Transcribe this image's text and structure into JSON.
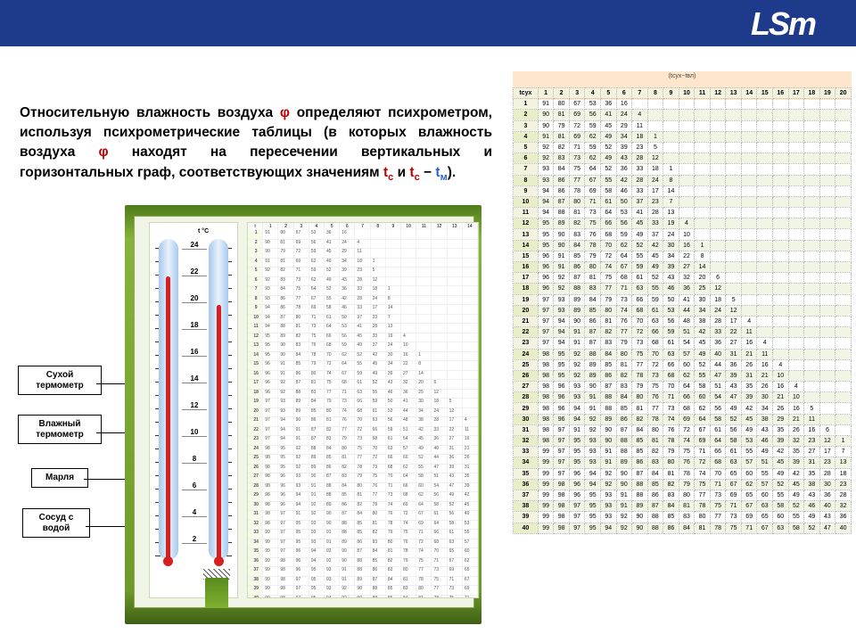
{
  "brand": "LSm",
  "paragraph": {
    "p1a": "Относительную влажность воздуха ",
    "phi": "φ",
    "p1b": " определяют психрометром, используя психрометрические таблицы (в которых влажность воздуха ",
    "p1c": " находят на пересечении вертикальных и горизонтальных граф, соответствующих значениям ",
    "tc": "t",
    "tc_sub": "с",
    "and": " и ",
    "tc2": "t",
    "tc2_sub": "с",
    "minus": " − ",
    "tm": "t",
    "tm_sub": "м",
    "p1d": ")."
  },
  "diagram": {
    "tc_label": "t °C",
    "scale": [
      "24",
      "22",
      "20",
      "18",
      "16",
      "14",
      "12",
      "10",
      "8",
      "6",
      "4",
      "2"
    ],
    "callouts": {
      "dry": "Сухой\nтермометр",
      "wet": "Влажный\nтермометр",
      "gauze": "Марля",
      "vessel": "Сосуд с\nводой"
    }
  },
  "big_table": {
    "header_note": "(tсух−tвл)",
    "row_head": "tсух",
    "cols": [
      "1",
      "2",
      "3",
      "4",
      "5",
      "6",
      "7",
      "8",
      "9",
      "10",
      "11",
      "12",
      "13",
      "14",
      "15",
      "16",
      "17",
      "18",
      "19",
      "20"
    ],
    "rows": [
      {
        "t": "1",
        "v": [
          "91",
          "80",
          "67",
          "53",
          "36",
          "16",
          "",
          "",
          "",
          "",
          "",
          "",
          "",
          "",
          "",
          "",
          "",
          "",
          "",
          ""
        ]
      },
      {
        "t": "2",
        "v": [
          "90",
          "81",
          "69",
          "56",
          "41",
          "24",
          "4",
          "",
          "",
          "",
          "",
          "",
          "",
          "",
          "",
          "",
          "",
          "",
          "",
          ""
        ]
      },
      {
        "t": "3",
        "v": [
          "90",
          "79",
          "72",
          "59",
          "45",
          "29",
          "11",
          "",
          "",
          "",
          "",
          "",
          "",
          "",
          "",
          "",
          "",
          "",
          "",
          ""
        ]
      },
      {
        "t": "4",
        "v": [
          "91",
          "81",
          "69",
          "62",
          "49",
          "34",
          "18",
          "1",
          "",
          "",
          "",
          "",
          "",
          "",
          "",
          "",
          "",
          "",
          "",
          ""
        ]
      },
      {
        "t": "5",
        "v": [
          "92",
          "82",
          "71",
          "59",
          "52",
          "39",
          "23",
          "5",
          "",
          "",
          "",
          "",
          "",
          "",
          "",
          "",
          "",
          "",
          "",
          ""
        ]
      },
      {
        "t": "6",
        "v": [
          "92",
          "83",
          "73",
          "62",
          "49",
          "43",
          "28",
          "12",
          "",
          "",
          "",
          "",
          "",
          "",
          "",
          "",
          "",
          "",
          "",
          ""
        ]
      },
      {
        "t": "7",
        "v": [
          "93",
          "84",
          "75",
          "64",
          "52",
          "36",
          "33",
          "18",
          "1",
          "",
          "",
          "",
          "",
          "",
          "",
          "",
          "",
          "",
          "",
          ""
        ]
      },
      {
        "t": "8",
        "v": [
          "93",
          "86",
          "77",
          "67",
          "55",
          "42",
          "28",
          "24",
          "8",
          "",
          "",
          "",
          "",
          "",
          "",
          "",
          "",
          "",
          "",
          ""
        ]
      },
      {
        "t": "9",
        "v": [
          "94",
          "86",
          "78",
          "69",
          "58",
          "46",
          "33",
          "17",
          "14",
          "",
          "",
          "",
          "",
          "",
          "",
          "",
          "",
          "",
          "",
          ""
        ]
      },
      {
        "t": "10",
        "v": [
          "94",
          "87",
          "80",
          "71",
          "61",
          "50",
          "37",
          "23",
          "7",
          "",
          "",
          "",
          "",
          "",
          "",
          "",
          "",
          "",
          "",
          ""
        ]
      },
      {
        "t": "11",
        "v": [
          "94",
          "88",
          "81",
          "73",
          "64",
          "53",
          "41",
          "28",
          "13",
          "",
          "",
          "",
          "",
          "",
          "",
          "",
          "",
          "",
          "",
          ""
        ]
      },
      {
        "t": "12",
        "v": [
          "95",
          "89",
          "82",
          "75",
          "66",
          "56",
          "45",
          "33",
          "19",
          "4",
          "",
          "",
          "",
          "",
          "",
          "",
          "",
          "",
          "",
          ""
        ]
      },
      {
        "t": "13",
        "v": [
          "95",
          "90",
          "83",
          "76",
          "68",
          "59",
          "49",
          "37",
          "24",
          "10",
          "",
          "",
          "",
          "",
          "",
          "",
          "",
          "",
          "",
          ""
        ]
      },
      {
        "t": "14",
        "v": [
          "95",
          "90",
          "84",
          "78",
          "70",
          "62",
          "52",
          "42",
          "30",
          "16",
          "1",
          "",
          "",
          "",
          "",
          "",
          "",
          "",
          "",
          ""
        ]
      },
      {
        "t": "15",
        "v": [
          "96",
          "91",
          "85",
          "79",
          "72",
          "64",
          "55",
          "45",
          "34",
          "22",
          "8",
          "",
          "",
          "",
          "",
          "",
          "",
          "",
          "",
          ""
        ]
      },
      {
        "t": "16",
        "v": [
          "96",
          "91",
          "86",
          "80",
          "74",
          "67",
          "59",
          "49",
          "39",
          "27",
          "14",
          "",
          "",
          "",
          "",
          "",
          "",
          "",
          "",
          ""
        ]
      },
      {
        "t": "17",
        "v": [
          "96",
          "92",
          "87",
          "81",
          "75",
          "68",
          "61",
          "52",
          "43",
          "32",
          "20",
          "6",
          "",
          "",
          "",
          "",
          "",
          "",
          "",
          ""
        ]
      },
      {
        "t": "18",
        "v": [
          "96",
          "92",
          "88",
          "83",
          "77",
          "71",
          "63",
          "55",
          "46",
          "36",
          "25",
          "12",
          "",
          "",
          "",
          "",
          "",
          "",
          "",
          ""
        ]
      },
      {
        "t": "19",
        "v": [
          "97",
          "93",
          "89",
          "84",
          "79",
          "73",
          "66",
          "59",
          "50",
          "41",
          "30",
          "18",
          "5",
          "",
          "",
          "",
          "",
          "",
          "",
          ""
        ]
      },
      {
        "t": "20",
        "v": [
          "97",
          "93",
          "89",
          "85",
          "80",
          "74",
          "68",
          "61",
          "53",
          "44",
          "34",
          "24",
          "12",
          "",
          "",
          "",
          "",
          "",
          "",
          ""
        ]
      },
      {
        "t": "21",
        "v": [
          "97",
          "94",
          "90",
          "86",
          "81",
          "76",
          "70",
          "63",
          "56",
          "48",
          "38",
          "28",
          "17",
          "4",
          "",
          "",
          "",
          "",
          "",
          ""
        ]
      },
      {
        "t": "22",
        "v": [
          "97",
          "94",
          "91",
          "87",
          "82",
          "77",
          "72",
          "66",
          "59",
          "51",
          "42",
          "33",
          "22",
          "11",
          "",
          "",
          "",
          "",
          "",
          ""
        ]
      },
      {
        "t": "23",
        "v": [
          "97",
          "94",
          "91",
          "87",
          "83",
          "79",
          "73",
          "68",
          "61",
          "54",
          "45",
          "36",
          "27",
          "16",
          "4",
          "",
          "",
          "",
          "",
          ""
        ]
      },
      {
        "t": "24",
        "v": [
          "98",
          "95",
          "92",
          "88",
          "84",
          "80",
          "75",
          "70",
          "63",
          "57",
          "49",
          "40",
          "31",
          "21",
          "11",
          "",
          "",
          "",
          "",
          ""
        ]
      },
      {
        "t": "25",
        "v": [
          "98",
          "95",
          "92",
          "89",
          "85",
          "81",
          "77",
          "72",
          "66",
          "60",
          "52",
          "44",
          "36",
          "26",
          "16",
          "4",
          "",
          "",
          "",
          ""
        ]
      },
      {
        "t": "26",
        "v": [
          "98",
          "95",
          "92",
          "89",
          "86",
          "82",
          "78",
          "73",
          "68",
          "62",
          "55",
          "47",
          "39",
          "31",
          "21",
          "10",
          "",
          "",
          "",
          ""
        ]
      },
      {
        "t": "27",
        "v": [
          "98",
          "96",
          "93",
          "90",
          "87",
          "83",
          "79",
          "75",
          "70",
          "64",
          "58",
          "51",
          "43",
          "35",
          "26",
          "16",
          "4",
          "",
          "",
          ""
        ]
      },
      {
        "t": "28",
        "v": [
          "98",
          "96",
          "93",
          "91",
          "88",
          "84",
          "80",
          "76",
          "71",
          "66",
          "60",
          "54",
          "47",
          "39",
          "30",
          "21",
          "10",
          "",
          "",
          ""
        ]
      },
      {
        "t": "29",
        "v": [
          "98",
          "96",
          "94",
          "91",
          "88",
          "85",
          "81",
          "77",
          "73",
          "68",
          "62",
          "56",
          "49",
          "42",
          "34",
          "26",
          "16",
          "5",
          "",
          ""
        ]
      },
      {
        "t": "30",
        "v": [
          "98",
          "96",
          "94",
          "92",
          "89",
          "86",
          "82",
          "78",
          "74",
          "69",
          "64",
          "58",
          "52",
          "45",
          "38",
          "29",
          "21",
          "11",
          "",
          ""
        ]
      },
      {
        "t": "31",
        "v": [
          "98",
          "97",
          "91",
          "92",
          "90",
          "87",
          "84",
          "80",
          "76",
          "72",
          "67",
          "61",
          "56",
          "49",
          "43",
          "35",
          "26",
          "16",
          "6",
          ""
        ]
      },
      {
        "t": "32",
        "v": [
          "98",
          "97",
          "95",
          "93",
          "90",
          "88",
          "85",
          "81",
          "78",
          "74",
          "69",
          "64",
          "58",
          "53",
          "46",
          "39",
          "32",
          "23",
          "12",
          "1"
        ]
      },
      {
        "t": "33",
        "v": [
          "99",
          "97",
          "95",
          "93",
          "91",
          "88",
          "85",
          "82",
          "79",
          "75",
          "71",
          "66",
          "61",
          "55",
          "49",
          "42",
          "35",
          "27",
          "17",
          "7"
        ]
      },
      {
        "t": "34",
        "v": [
          "99",
          "97",
          "95",
          "93",
          "91",
          "89",
          "86",
          "83",
          "80",
          "76",
          "72",
          "68",
          "63",
          "57",
          "51",
          "45",
          "39",
          "31",
          "23",
          "13"
        ]
      },
      {
        "t": "35",
        "v": [
          "99",
          "97",
          "96",
          "94",
          "92",
          "90",
          "87",
          "84",
          "81",
          "78",
          "74",
          "70",
          "65",
          "60",
          "55",
          "49",
          "42",
          "35",
          "28",
          "18"
        ]
      },
      {
        "t": "36",
        "v": [
          "99",
          "98",
          "96",
          "94",
          "92",
          "90",
          "88",
          "85",
          "82",
          "79",
          "75",
          "71",
          "67",
          "62",
          "57",
          "52",
          "45",
          "38",
          "30",
          "23"
        ]
      },
      {
        "t": "37",
        "v": [
          "99",
          "98",
          "96",
          "95",
          "93",
          "91",
          "88",
          "86",
          "83",
          "80",
          "77",
          "73",
          "69",
          "65",
          "60",
          "55",
          "49",
          "43",
          "36",
          "28"
        ]
      },
      {
        "t": "38",
        "v": [
          "99",
          "98",
          "97",
          "95",
          "93",
          "91",
          "89",
          "87",
          "84",
          "81",
          "78",
          "75",
          "71",
          "67",
          "63",
          "58",
          "52",
          "46",
          "40",
          "32"
        ]
      },
      {
        "t": "39",
        "v": [
          "99",
          "98",
          "97",
          "95",
          "93",
          "92",
          "90",
          "88",
          "85",
          "83",
          "80",
          "77",
          "73",
          "69",
          "65",
          "60",
          "55",
          "49",
          "43",
          "36"
        ]
      },
      {
        "t": "40",
        "v": [
          "99",
          "98",
          "97",
          "95",
          "94",
          "92",
          "90",
          "88",
          "86",
          "84",
          "81",
          "78",
          "75",
          "71",
          "67",
          "63",
          "58",
          "52",
          "47",
          "40"
        ]
      }
    ]
  }
}
